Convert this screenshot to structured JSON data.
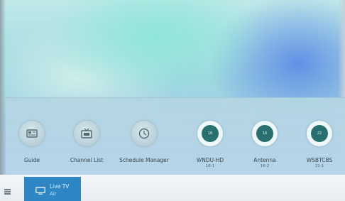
{
  "menu": {
    "items": [
      {
        "label": "Guide",
        "icon": "guide-icon"
      },
      {
        "label": "Channel List",
        "icon": "channel-list-icon"
      },
      {
        "label": "Schedule Manager",
        "icon": "clock-icon"
      }
    ],
    "channels": [
      {
        "label": "WNDU-HD",
        "number": "16-1",
        "badge": "16"
      },
      {
        "label": "Antenna",
        "number": "16-2",
        "badge": "16"
      },
      {
        "label": "WSBTCBS",
        "number": "22-1",
        "badge": "22"
      }
    ]
  },
  "source": {
    "title": "Live TV",
    "subtitle": "Air",
    "icon": "tv-icon"
  },
  "colors": {
    "panel": "#b6d4e4",
    "channel_badge": "#27706f",
    "source_tile": "#2e86c4"
  }
}
